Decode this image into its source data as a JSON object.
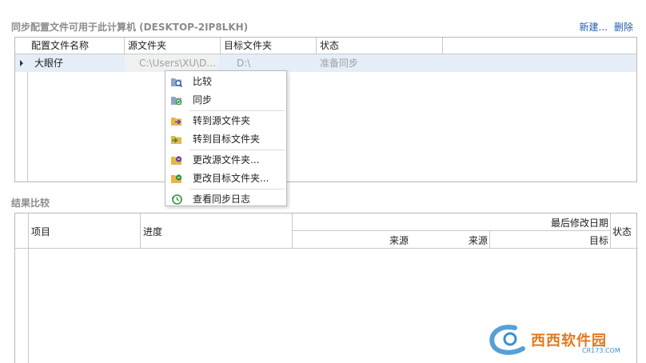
{
  "sync_section": {
    "title": "同步配置文件可用于此计算机 (DESKTOP-2IP8LKH)",
    "new_label": "新建...",
    "delete_label": "删除",
    "columns": [
      "配置文件名称",
      "源文件夹",
      "目标文件夹",
      "状态"
    ],
    "rows": [
      {
        "name": "大眼仔",
        "source": "C:\\Users\\XU\\D...",
        "target": "D:\\",
        "status": "准备同步"
      }
    ]
  },
  "context_menu": {
    "items": [
      {
        "label": "比较",
        "icon": "folder-search-icon"
      },
      {
        "label": "同步",
        "icon": "folder-sync-icon"
      },
      {
        "label": "转到源文件夹",
        "icon": "folder-go-source-icon"
      },
      {
        "label": "转到目标文件夹",
        "icon": "folder-go-target-icon"
      },
      {
        "label": "更改源文件夹...",
        "icon": "folder-change-source-icon"
      },
      {
        "label": "更改目标文件夹...",
        "icon": "folder-change-target-icon"
      },
      {
        "label": "查看同步日志",
        "icon": "history-clock-icon"
      }
    ]
  },
  "results_section": {
    "title": "结果比较",
    "col_item": "项目",
    "col_progress": "进度",
    "col_last_modified": "最后修改日期",
    "col_source": "来源",
    "col_source2": "来源",
    "col_target": "目标",
    "col_status": "状态"
  },
  "watermark": {
    "text": "西西软件园",
    "sub": "CR173.COM"
  },
  "colors": {
    "accent_link": "#1f5fae",
    "row_selected": "#e5eef8",
    "folder": "#e8b54a"
  }
}
